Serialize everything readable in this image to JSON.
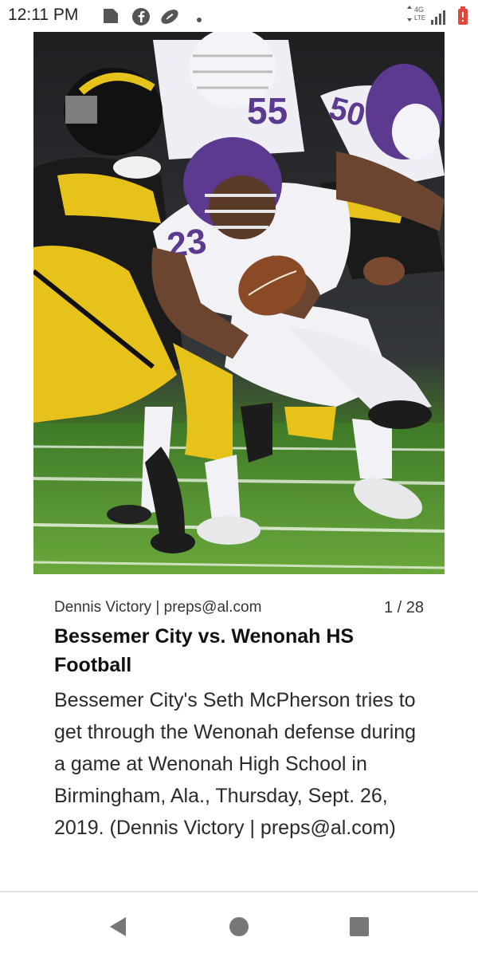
{
  "status_bar": {
    "time": "12:11 PM",
    "network": "4G LTE",
    "icons": [
      "file-icon",
      "facebook-icon",
      "football-icon",
      "dot-icon",
      "network-icon",
      "signal-icon",
      "battery-icon"
    ]
  },
  "photo": {
    "alt": "Bessemer City vs. Wenonah HS Football",
    "jersey_number": "23"
  },
  "article": {
    "credit": "Dennis Victory | preps@al.com",
    "counter": "1 / 28",
    "headline": "Bessemer City vs. Wenonah HS Football",
    "caption": "Bessemer City's Seth McPherson tries to get through the Wenonah defense during a game at Wenonah High School in Birmingham, Ala., Thursday, Sept. 26, 2019. (Dennis Victory | preps@al.com)"
  },
  "nav": {
    "back": "back-icon",
    "home": "home-icon",
    "recents": "recents-icon"
  },
  "colors": {
    "purple": "#5b3a8f",
    "gold": "#e6c21a",
    "field": "#4e8a2c",
    "battery": "#e0483a"
  }
}
